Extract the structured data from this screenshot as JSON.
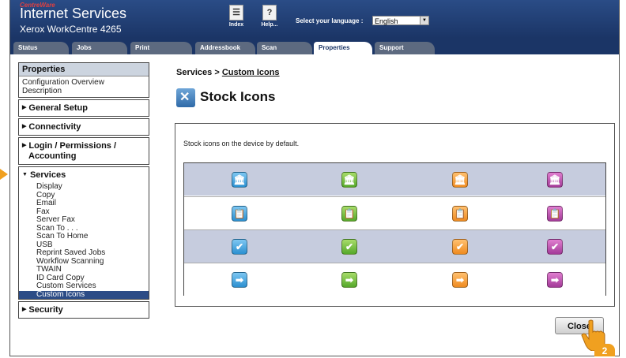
{
  "header": {
    "brand_small": "CentreWare",
    "brand_title": "Internet Services",
    "model": "Xerox WorkCentre 4265",
    "index_label": "Index",
    "help_label": "Help...",
    "language_label": "Select your language :",
    "language_value": "English"
  },
  "tabs": [
    {
      "label": "Status"
    },
    {
      "label": "Jobs"
    },
    {
      "label": "Print"
    },
    {
      "label": "Addressbook"
    },
    {
      "label": "Scan"
    },
    {
      "label": "Properties"
    },
    {
      "label": "Support"
    }
  ],
  "nav": {
    "heading": "Properties",
    "config_overview": "Configuration Overview",
    "description": "Description",
    "general_setup": "General Setup",
    "connectivity": "Connectivity",
    "login_permissions": "Login / Permissions /",
    "accounting": "Accounting",
    "services": "Services",
    "services_items": [
      "Display",
      "Copy",
      "Email",
      "Fax",
      "Server Fax",
      "Scan To . . .",
      "Scan To Home",
      "USB",
      "Reprint Saved Jobs",
      "Workflow Scanning",
      "TWAIN",
      "ID Card Copy",
      "Custom Services",
      "Custom Icons"
    ],
    "security": "Security"
  },
  "content": {
    "crumb_prefix": "Services > ",
    "crumb_link": "Custom Icons",
    "title": "Stock Icons",
    "panel_text": "Stock icons on the device by default.",
    "icon_rows": [
      {
        "glyph": "🏛",
        "names": [
          "bank-icon-blue",
          "bank-icon-green",
          "bank-icon-orange",
          "bank-icon-purple"
        ]
      },
      {
        "glyph": "📋",
        "names": [
          "clipboard-icon-blue",
          "clipboard-icon-green",
          "clipboard-icon-orange",
          "clipboard-icon-purple"
        ]
      },
      {
        "glyph": "✔",
        "names": [
          "check-icon-blue",
          "check-icon-green",
          "check-icon-orange",
          "check-icon-purple"
        ]
      },
      {
        "glyph": "➡",
        "names": [
          "arrow-icon-blue",
          "arrow-icon-green",
          "arrow-icon-orange",
          "arrow-icon-purple"
        ]
      }
    ],
    "close_label": "Close",
    "step_badge": "2"
  },
  "colors": {
    "header_bg": "#1b3566",
    "selected_nav": "#2c4c86",
    "row_shade": "#c6ccde",
    "marker": "#f0a020"
  }
}
